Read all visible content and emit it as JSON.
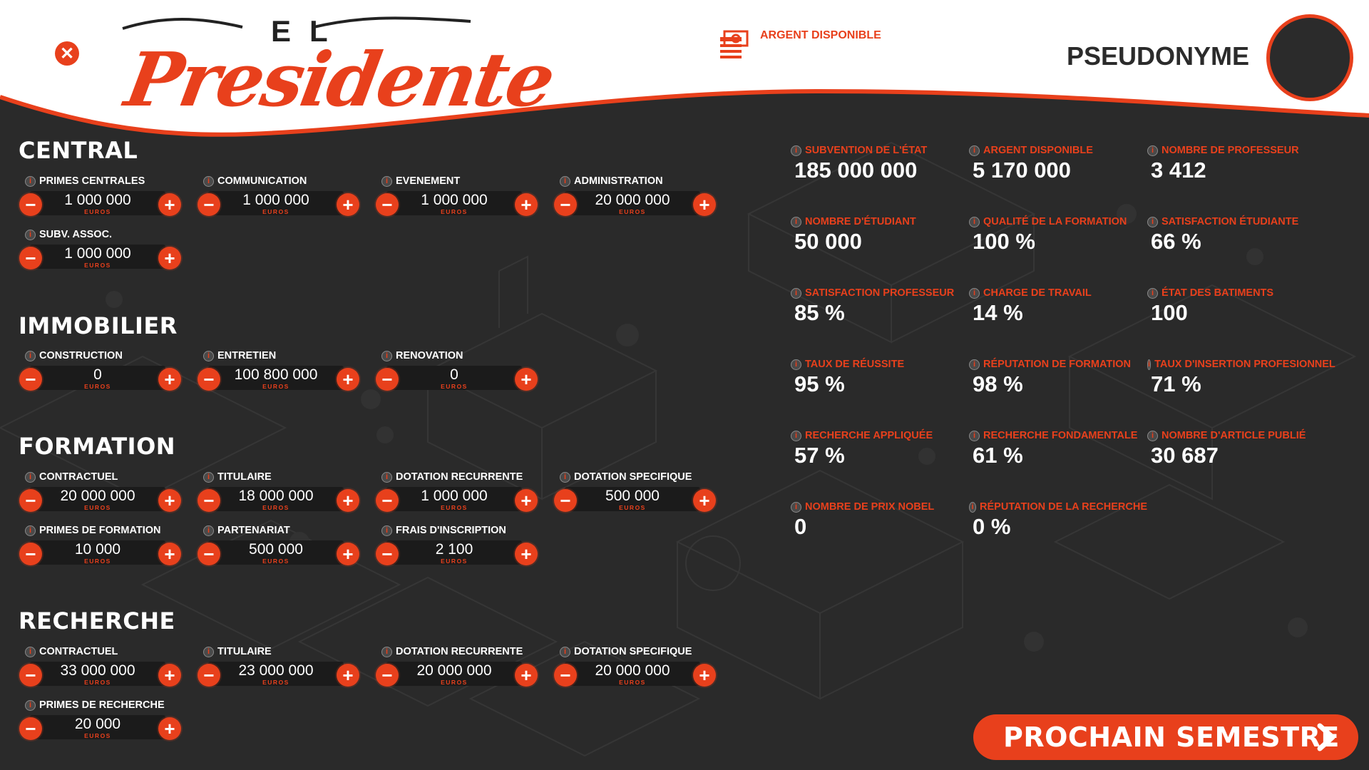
{
  "header": {
    "logo_el": "EL",
    "logo_main": "Presidente",
    "money_label": "ARGENT DISPONIBLE",
    "pseudonym": "PSEUDONYME"
  },
  "colors": {
    "accent": "#e8401c",
    "background": "#2a2a2a",
    "header": "#ffffff"
  },
  "icons": {
    "close": "close-icon",
    "money": "money-icon",
    "info": "info-icon",
    "next": "chevron-right-icon"
  },
  "unit": "EUROS",
  "sections": {
    "central": {
      "title": "CENTRAL",
      "items": [
        {
          "label": "PRIMES CENTRALES",
          "value": "1 000 000"
        },
        {
          "label": "COMMUNICATION",
          "value": "1 000 000"
        },
        {
          "label": "EVENEMENT",
          "value": "1 000 000"
        },
        {
          "label": "ADMINISTRATION",
          "value": "20 000 000"
        },
        {
          "label": "SUBV. ASSOC.",
          "value": "1 000 000"
        }
      ]
    },
    "immobilier": {
      "title": "IMMOBILIER",
      "items": [
        {
          "label": "CONSTRUCTION",
          "value": "0"
        },
        {
          "label": "ENTRETIEN",
          "value": "100 800 000"
        },
        {
          "label": "RENOVATION",
          "value": "0"
        }
      ]
    },
    "formation": {
      "title": "FORMATION",
      "items": [
        {
          "label": "CONTRACTUEL",
          "value": "20 000 000"
        },
        {
          "label": "TITULAIRE",
          "value": "18 000 000"
        },
        {
          "label": "DOTATION RECURRENTE",
          "value": "1 000 000"
        },
        {
          "label": "DOTATION SPECIFIQUE",
          "value": "500 000"
        },
        {
          "label": "PRIMES DE FORMATION",
          "value": "10 000"
        },
        {
          "label": "PARTENARIAT",
          "value": "500 000"
        },
        {
          "label": "FRAIS D'INSCRIPTION",
          "value": "2 100"
        }
      ]
    },
    "recherche": {
      "title": "RECHERCHE",
      "items": [
        {
          "label": "CONTRACTUEL",
          "value": "33 000 000"
        },
        {
          "label": "TITULAIRE",
          "value": "23 000 000"
        },
        {
          "label": "DOTATION RECURRENTE",
          "value": "20 000 000"
        },
        {
          "label": "DOTATION SPECIFIQUE",
          "value": "20 000 000"
        },
        {
          "label": "PRIMES DE RECHERCHE",
          "value": "20 000"
        }
      ]
    }
  },
  "stats": [
    {
      "label": "SUBVENTION DE L'ÉTAT",
      "value": "185 000 000"
    },
    {
      "label": "ARGENT DISPONIBLE",
      "value": "5 170 000"
    },
    {
      "label": "NOMBRE DE PROFESSEUR",
      "value": "3 412"
    },
    {
      "label": "NOMBRE D'ÉTUDIANT",
      "value": "50 000"
    },
    {
      "label": "QUALITÉ DE LA FORMATION",
      "value": "100 %"
    },
    {
      "label": "SATISFACTION ÉTUDIANTE",
      "value": "66 %"
    },
    {
      "label": "SATISFACTION PROFESSEUR",
      "value": "85 %"
    },
    {
      "label": "CHARGE DE TRAVAIL",
      "value": "14 %"
    },
    {
      "label": "ÉTAT DES BATIMENTS",
      "value": "100"
    },
    {
      "label": "TAUX DE RÉUSSITE",
      "value": "95 %"
    },
    {
      "label": "RÉPUTATION DE FORMATION",
      "value": "98 %"
    },
    {
      "label": "TAUX D'INSERTION PROFESIONNEL",
      "value": "71 %"
    },
    {
      "label": "RECHERCHE APPLIQUÉE",
      "value": "57 %"
    },
    {
      "label": "RECHERCHE FONDAMENTALE",
      "value": "61 %"
    },
    {
      "label": "NOMBRE D'ARTICLE PUBLIÉ",
      "value": "30 687"
    },
    {
      "label": "NOMBRE DE PRIX NOBEL",
      "value": "0"
    },
    {
      "label": "RÉPUTATION DE LA RECHERCHE",
      "value": "0 %"
    }
  ],
  "next_button": "PROCHAIN SEMESTRE"
}
